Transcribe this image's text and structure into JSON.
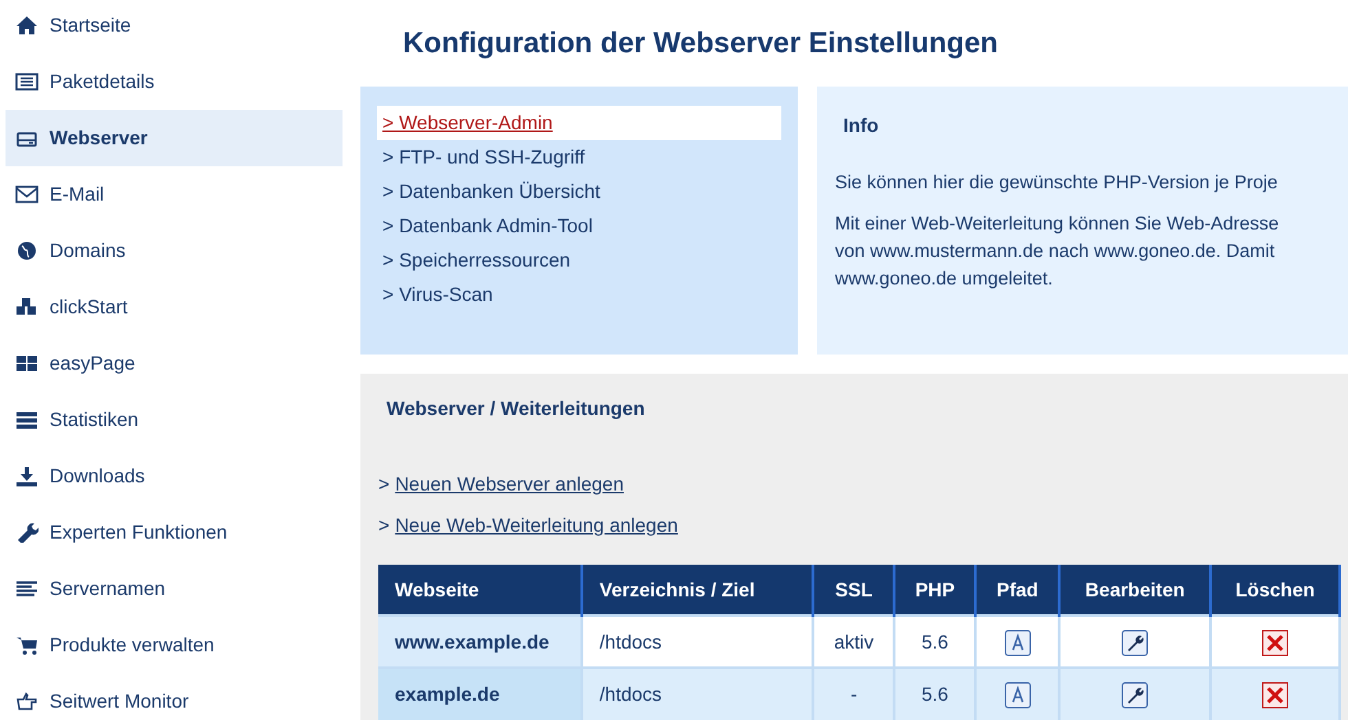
{
  "sidebar": {
    "items": [
      {
        "label": "Startseite",
        "selected": false
      },
      {
        "label": "Paketdetails",
        "selected": false
      },
      {
        "label": "Webserver",
        "selected": true
      },
      {
        "label": "E-Mail",
        "selected": false
      },
      {
        "label": "Domains",
        "selected": false
      },
      {
        "label": "clickStart",
        "selected": false
      },
      {
        "label": "easyPage",
        "selected": false
      },
      {
        "label": "Statistiken",
        "selected": false
      },
      {
        "label": "Downloads",
        "selected": false
      },
      {
        "label": "Experten Funktionen",
        "selected": false
      },
      {
        "label": "Servernamen",
        "selected": false
      },
      {
        "label": "Produkte verwalten",
        "selected": false
      },
      {
        "label": "Seitwert Monitor",
        "selected": false
      }
    ]
  },
  "title": "Konfiguration der Webserver Einstellungen",
  "submenu": [
    {
      "label": "> Webserver-Admin",
      "selected": true
    },
    {
      "label": "> FTP- und SSH-Zugriff",
      "selected": false
    },
    {
      "label": "> Datenbanken Übersicht",
      "selected": false
    },
    {
      "label": "> Datenbank Admin-Tool",
      "selected": false
    },
    {
      "label": "> Speicherressourcen",
      "selected": false
    },
    {
      "label": "> Virus-Scan",
      "selected": false
    }
  ],
  "info": {
    "title": "Info",
    "paragraphs": [
      [
        "Sie können hier die gewünschte PHP-Version je Proje"
      ],
      [
        "Mit einer Web-Weiterleitung können Sie Web-Adresse",
        "von www.mustermann.de nach www.goneo.de. Damit",
        "www.goneo.de umgeleitet."
      ]
    ]
  },
  "section": {
    "title": "Webserver / Weiterleitungen",
    "links": [
      {
        "marker": ">",
        "label": "Neuen Webserver anlegen"
      },
      {
        "marker": ">",
        "label": "Neue Web-Weiterleitung anlegen"
      }
    ],
    "table": {
      "columns": [
        "Webseite",
        "Verzeichnis / Ziel",
        "SSL",
        "PHP",
        "Pfad",
        "Bearbeiten",
        "Löschen"
      ],
      "rows": [
        {
          "website": "www.example.de",
          "directory": "/htdocs",
          "ssl": "aktiv",
          "php": "5.6"
        },
        {
          "website": "example.de",
          "directory": "/htdocs",
          "ssl": "-",
          "php": "5.6"
        }
      ]
    }
  }
}
